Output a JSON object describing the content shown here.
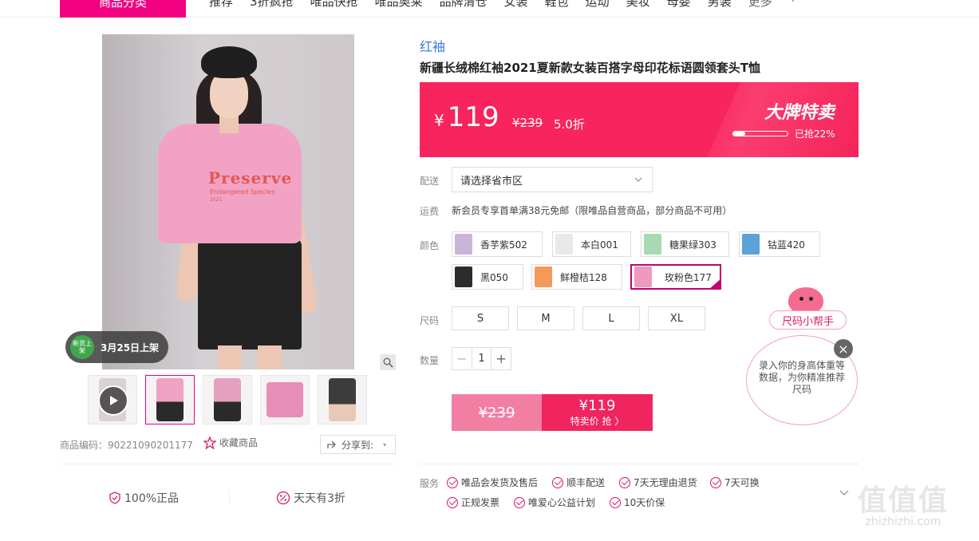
{
  "header": {
    "category_button": "商品分类",
    "nav": [
      "推荐",
      "3折疯抢",
      "唯品快抢",
      "唯品奥莱",
      "品牌清仓",
      "女装",
      "鞋包",
      "运动",
      "美妆",
      "母婴",
      "男装"
    ],
    "more": "更多"
  },
  "gallery": {
    "shirt_text": "Preserve",
    "shirt_sub": "Endangered Species",
    "shirt_year": "2021",
    "new_badge": "新货上架",
    "new_date": "3月25日上架",
    "thumbs": [
      {
        "color": "#d8d2d4",
        "video": true
      },
      {
        "color": "#efa3c2",
        "video": false
      },
      {
        "color": "#e6a0bf",
        "video": false
      },
      {
        "color": "#e88eb6",
        "video": false
      },
      {
        "color": "#3c3c3c",
        "video": false
      }
    ],
    "product_code": "商品编码：90221090201177",
    "favorite": "收藏商品",
    "share": "分享到:"
  },
  "guarantees": [
    "100%正品",
    "天天有3折"
  ],
  "product": {
    "brand": "红袖",
    "title": "新疆长绒棉红袖2021夏新款女装百搭字母印花标语圆领套头T恤",
    "currency": "¥",
    "price": "119",
    "original_price": "¥239",
    "discount": "5.0折",
    "sale_label": "大牌特卖",
    "sold_progress": 0.22,
    "sold_text": "已抢22%"
  },
  "labels": {
    "delivery": "配送",
    "shipping": "运费",
    "color": "颜色",
    "size": "尺码",
    "quantity": "数量",
    "service": "服务"
  },
  "delivery_placeholder": "请选择省市区",
  "shipping_text": "新会员专享首单满38元免邮（限唯品自营商品，部分商品不可用）",
  "colors": [
    {
      "name": "香芋紫502",
      "swatch": "#c9b5d9"
    },
    {
      "name": "本白001",
      "swatch": "#e9e9e9"
    },
    {
      "name": "糖果绿303",
      "swatch": "#a7d9b5"
    },
    {
      "name": "钴蓝420",
      "swatch": "#5aa3d8"
    },
    {
      "name": "黑050",
      "swatch": "#2c2c2c"
    },
    {
      "name": "鲜橙桔128",
      "swatch": "#f29a5a"
    },
    {
      "name": "玫粉色177",
      "swatch": "#f098bd"
    }
  ],
  "sizes": [
    "S",
    "M",
    "L",
    "XL"
  ],
  "quantity": "1",
  "buy": {
    "old_price": "¥239",
    "price": "¥119",
    "label": "特卖价 抢 〉"
  },
  "services": [
    "唯品会发货及售后",
    "顺丰配送",
    "7天无理由退货",
    "7天可换",
    "正规发票",
    "唯爱心公益计划",
    "10天价保"
  ],
  "size_helper": {
    "tag": "尺码小帮手",
    "text": "录入你的身高体重等数据，为你精准推荐尺码"
  },
  "watermark": {
    "mark": "值值值",
    "site": "zhizhizhi.com"
  },
  "colors_theme": {
    "accent": "#f10180",
    "sale": "#f8245d",
    "brand_link": "#3a7ce0"
  }
}
